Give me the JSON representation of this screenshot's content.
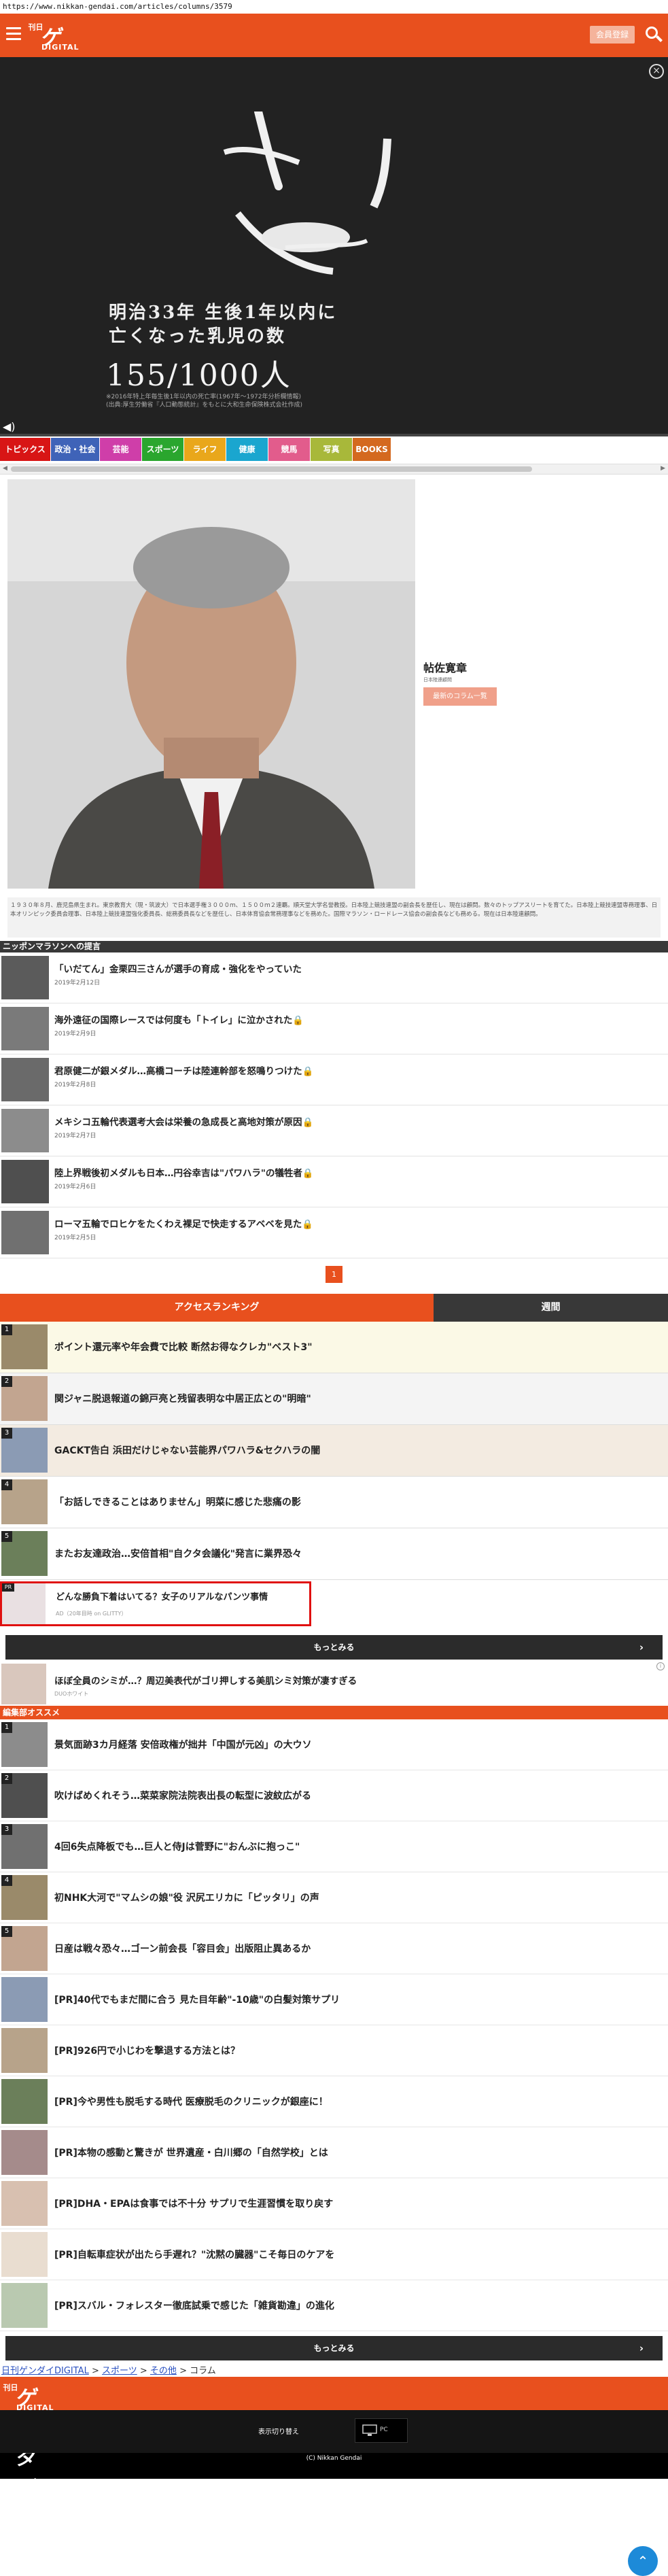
{
  "browser": {
    "url": "https://www.nikkan-gendai.com/articles/columns/3579"
  },
  "header": {
    "logo_small": "日刊",
    "logo_big": "ゲンダイ",
    "logo_sub": "DIGITAL",
    "member_label": "会員登録"
  },
  "hero": {
    "line1": "明治33年 生後1年以内に",
    "line2": "亡くなった乳児の数",
    "big": "155/1000人",
    "note1": "※2016年特上年毎生後1年以内の死亡率(1967年〜1972年分析欄情報)",
    "note2": "(出典:厚生労働省『人口動態統計』をもとに大和生命保険株式会社作成)"
  },
  "nav": {
    "items": [
      {
        "label": "トピックス",
        "color": "#d81515"
      },
      {
        "label": "政治・社会",
        "color": "#3f63b8"
      },
      {
        "label": "芸能",
        "color": "#cf3ea9"
      },
      {
        "label": "スポーツ",
        "color": "#2aa62e"
      },
      {
        "label": "ライフ",
        "color": "#e9a71b"
      },
      {
        "label": "健康",
        "color": "#1aa6cf"
      },
      {
        "label": "競馬",
        "color": "#e25c8c"
      },
      {
        "label": "写真",
        "color": "#a8b83a"
      },
      {
        "label": "BOOKS",
        "color": "#d4691f"
      }
    ]
  },
  "profile": {
    "name": "帖佐寛章",
    "subtitle": "日本陸連顧問",
    "button": "最新のコラム一覧",
    "bio": "１９３０年８月、鹿児島県生まれ。東京教育大（現・筑波大）で日本選手権３０００ｍ、１５００ｍ２連覇。順天堂大学名誉教授。日本陸上競技連盟の副会長を歴任し、現在は顧問。数々のトップアスリートを育てた。日本陸上競技連盟専務理事、日本オリンピック委員会理事、日本陸上競技連盟強化委員長、総務委員長などを歴任し、日本体育協会常務理事などを務めた。国際マラソン・ロードレース協会の副会長なども務める。現在は日本陸連顧問。"
  },
  "column": {
    "title": "ニッポンマラソンへの提言",
    "items": [
      {
        "title": "「いだてん」金栗四三さんが選手の育成・強化をやっていた",
        "date": "2019年2月12日"
      },
      {
        "title": "海外遠征の国際レースでは何度も「トイレ」に泣かされた🔒",
        "date": "2019年2月9日"
      },
      {
        "title": "君原健二が銀メダル…高橋コーチは陸連幹部を怒鳴りつけた🔒",
        "date": "2019年2月8日"
      },
      {
        "title": "メキシコ五輪代表選考大会は栄養の急成長と高地対策が原因🔒",
        "date": "2019年2月7日"
      },
      {
        "title": "陸上界戦後初メダルも日本…円谷幸吉は\"パワハラ\"の犠牲者🔒",
        "date": "2019年2月6日"
      },
      {
        "title": "ローマ五輪でロヒケをたくわえ裸足で快走するアベベを見た🔒",
        "date": "2019年2月5日"
      }
    ],
    "page": "1"
  },
  "ranking": {
    "tab1": "アクセスランキング",
    "tab2": "週間",
    "items": [
      {
        "n": "1",
        "title": "ポイント還元率や年会費で比較 断然お得なクレカ\"ベスト3\"",
        "bg": "#fbf9e6"
      },
      {
        "n": "2",
        "title": "関ジャニ脱退報道の錦戸亮と残留表明な中居正広との\"明暗\"",
        "bg": "#f4f4f4"
      },
      {
        "n": "3",
        "title": "GACKT告白 浜田だけじゃない芸能界パワハラ&セクハラの闇",
        "bg": "#f3ebe1"
      },
      {
        "n": "4",
        "title": "「お話しできることはありません」明菜に感じた悲痛の影",
        "bg": "#ffffff"
      },
      {
        "n": "5",
        "title": "またお友達政治…安倍首相\"自クタ会議化\"発言に業界恐々",
        "bg": "#ffffff"
      }
    ],
    "ad_title": "どんな勝負下着はいてる？女子のリアルなパンツ事情",
    "ad_source": "AD（20年目時 on GLITTY）",
    "more": "もっとみる"
  },
  "ad2": {
    "title": "ほぼ全員のシミが…？周辺美表代がゴリ押しする美肌シミ対策が凄すぎる",
    "source": "DUOホワイト"
  },
  "recommend": {
    "title": "編集部オススメ",
    "items": [
      {
        "n": "1",
        "title": "景気面跡3カ月経落 安倍政権が拙井「中国が元凶」の大ウソ"
      },
      {
        "n": "2",
        "title": "吹けばめくれそう…菜菜家院法院表出長の転型に波紋広がる"
      },
      {
        "n": "3",
        "title": "4回6失点降板でも…巨人と侍Jは菅野に\"おんぶに抱っこ\""
      },
      {
        "n": "4",
        "title": "初NHK大河で\"マムシの娘\"役 沢尻エリカに「ピッタリ」の声"
      },
      {
        "n": "5",
        "title": "日産は戦々恐々…ゴーン前会長「容目会」出版阻止異あるか"
      },
      {
        "n": "",
        "title": "[PR]40代でもまだ間に合う 見た目年齢\"-10歳\"の白髪対策サプリ"
      },
      {
        "n": "",
        "title": "[PR]926円で小じわを撃退する方法とは？"
      },
      {
        "n": "",
        "title": "[PR]今や男性も脱毛する時代 医療脱毛のクリニックが銀座に！"
      },
      {
        "n": "",
        "title": "[PR]本物の感動と驚きが 世界遺産・白川郷の「自然学校」とは"
      },
      {
        "n": "",
        "title": "[PR]DHA・EPAは食事では不十分 サプリで生涯習慣を取り戻す"
      },
      {
        "n": "",
        "title": "[PR]自転車症状が出たら手遅れ？\"沈黙の臓器\"こそ毎日のケアを"
      },
      {
        "n": "",
        "title": "[PR]スバル・フォレスター徹底試乗で感じた「雑貨勘違」の進化"
      }
    ],
    "more": "もっとみる"
  },
  "breadcrumb": {
    "home": "日刊ゲンダイDIGITAL",
    "sep": " > ",
    "sports": "スポーツ",
    "other": "その他",
    "current": "コラム"
  },
  "footer": {
    "switch_label": "表示切り替え",
    "pc_label": "PC",
    "copyright": "(C) Nikkan Gendai"
  },
  "colors": {
    "brand": "#e8501e",
    "dark": "#383838"
  }
}
